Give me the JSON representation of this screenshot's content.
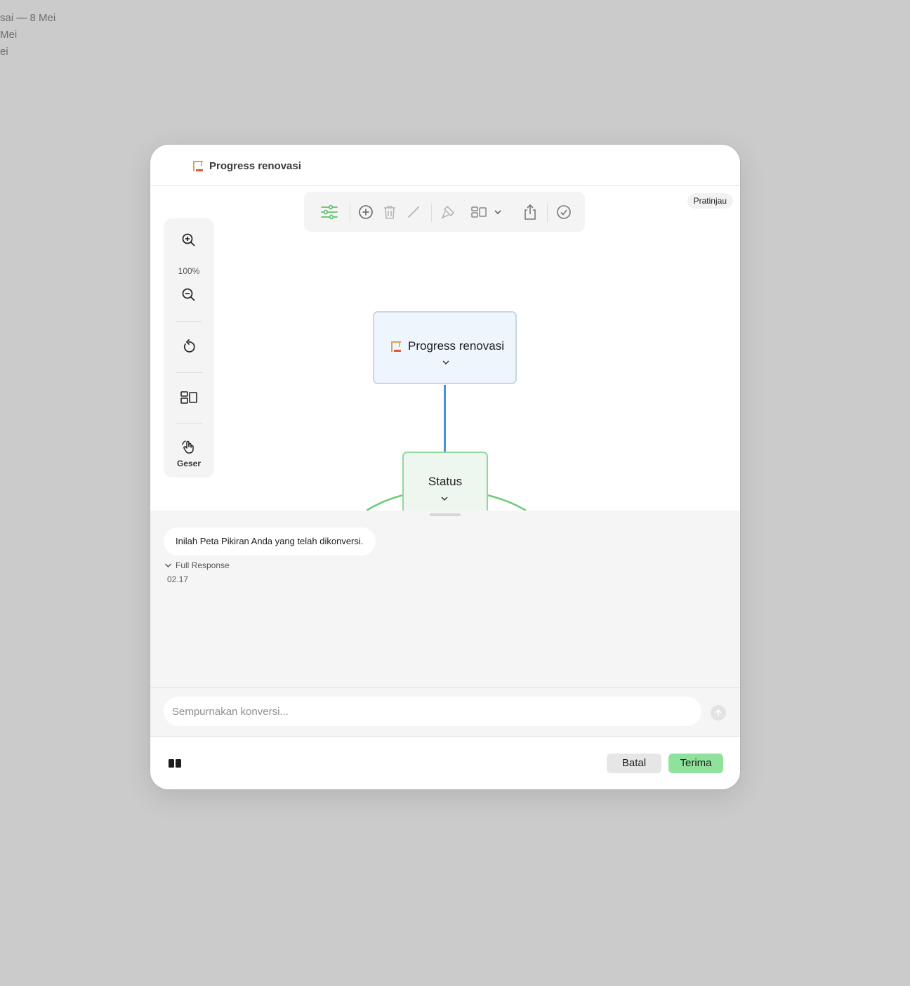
{
  "background": {
    "lines": [
      "sai — 8 Mei",
      "Mei",
      "ei"
    ]
  },
  "dialog": {
    "title": "Progress renovasi",
    "title_icon": "construction-crane-icon",
    "preview_badge": "Pratinjau"
  },
  "toolbar": {
    "items": [
      "settings-sliders-icon",
      "add-circle-icon",
      "trash-icon",
      "pencil-icon",
      "format-brush-icon",
      "layout-icon",
      "chevron-down-icon",
      "share-icon",
      "check-circle-icon"
    ],
    "accent": "#5cc46b"
  },
  "side_panel": {
    "zoom_level": "100%",
    "pan_label": "Geser"
  },
  "mindmap": {
    "root": {
      "label": "Progress renovasi",
      "icon": "construction-crane-icon"
    },
    "child": {
      "label": "Status"
    },
    "connector_color": "#4a90e2",
    "branch_color": "#6ccb7a"
  },
  "chat": {
    "message": "Inilah Peta Pikiran Anda yang telah dikonversi.",
    "full_response": "Full Response",
    "time": "02.17"
  },
  "input": {
    "placeholder": "Sempurnakan konversi..."
  },
  "footer": {
    "cancel_label": "Batal",
    "accept_label": "Terima",
    "accept_color": "#8fe29b"
  }
}
